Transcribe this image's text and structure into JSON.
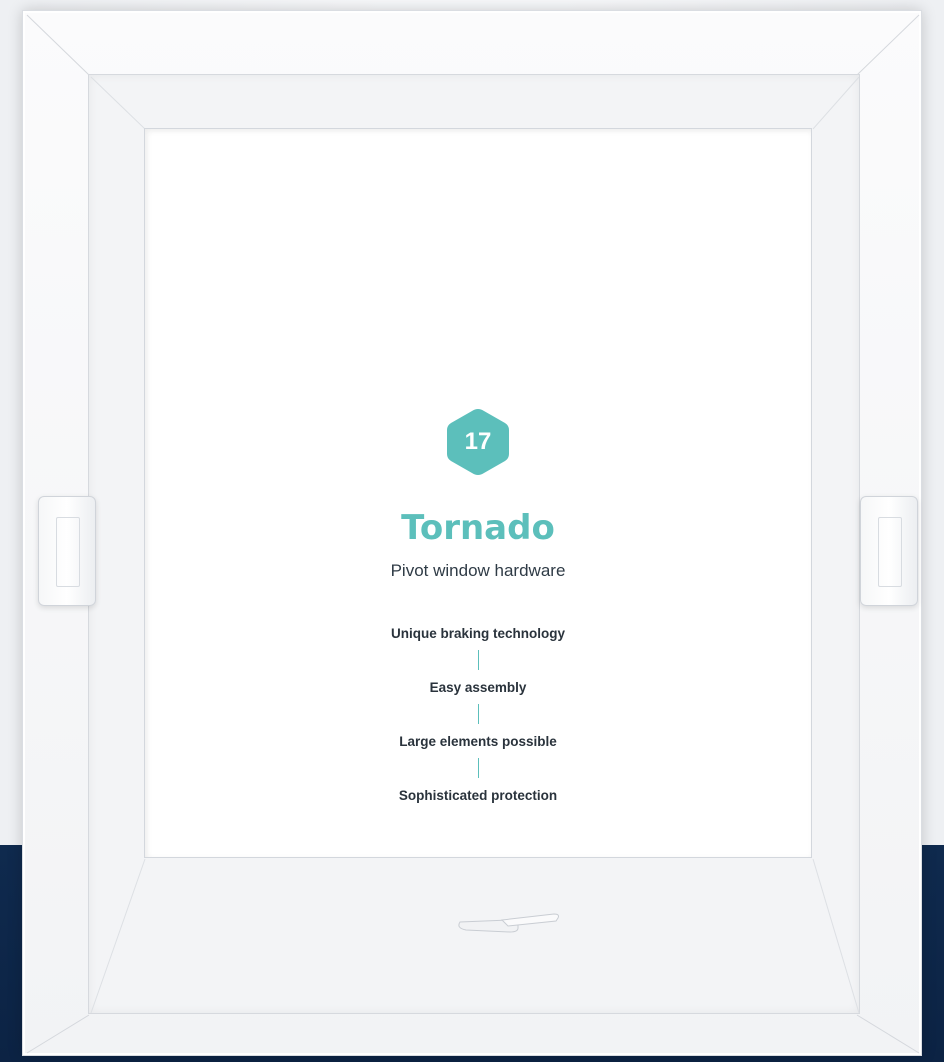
{
  "product": {
    "badge_number": "17",
    "name": "Tornado",
    "subtitle": "Pivot window hardware"
  },
  "features": [
    "Unique braking technology",
    "Easy assembly",
    "Large elements possible",
    "Sophisticated protection"
  ],
  "colors": {
    "accent": "#5cbfbb",
    "navy_background": "#0f2a4e",
    "frame": "#f7f8f9"
  }
}
